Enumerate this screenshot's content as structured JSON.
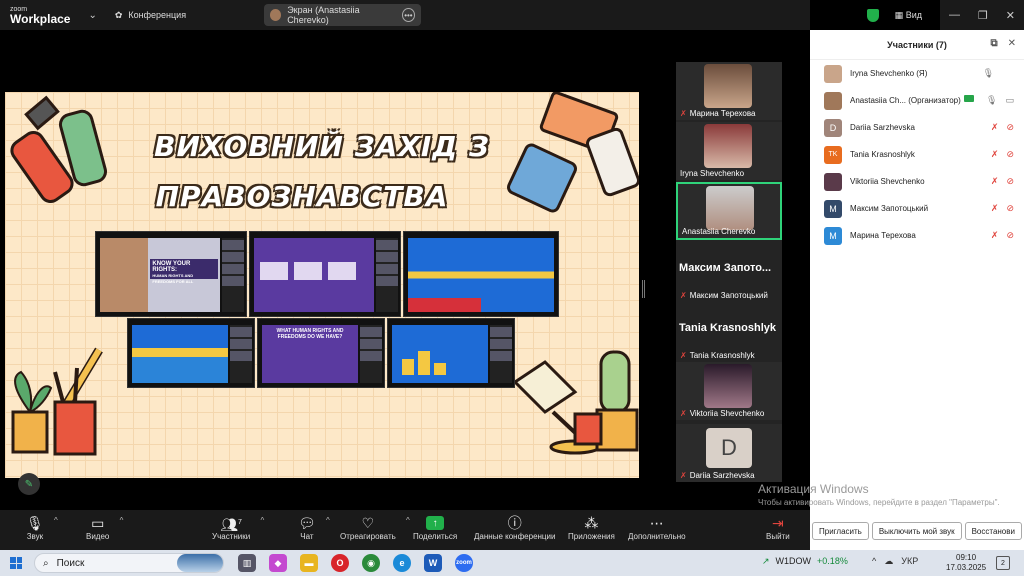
{
  "window": {
    "logo_top": "zoom",
    "logo_bottom": "Workplace",
    "meeting_label": "Конференция",
    "share_label": "Экран (Anastasiia Cherevko)",
    "view_label": "Вид",
    "colors": {
      "accent": "#21b04b",
      "danger": "#e0443d",
      "active_border": "#2fd37a"
    }
  },
  "slide": {
    "title_line1": "ВИХОВНИЙ ЗАХІД З",
    "title_line2": "ПРАВОЗНАВСТВА",
    "thumb1_title": "KNOW YOUR RIGHTS:",
    "thumb1_sub": "HUMAN RIGHTS AND FREEDOMS FOR ALL",
    "thumb5_title": "WHAT HUMAN RIGHTS AND FREEDOMS DO WE HAVE?"
  },
  "strip": {
    "tiles": [
      {
        "name": "Марина Терехова"
      },
      {
        "name": "Iryna Shevchenko"
      },
      {
        "name": "Anastasiia Cherevko"
      },
      {
        "big": "Максим Запото...",
        "name": "Максим Запотоцький"
      },
      {
        "big": "Tania Krasnoshlyk",
        "name": "Tania Krasnoshlyk"
      },
      {
        "name": "Viktoriia Shevchenko"
      },
      {
        "letter": "D",
        "name": "Dariia Sarzhevska"
      }
    ]
  },
  "panel": {
    "title": "Участники (7)",
    "participants": [
      {
        "name": "Iryna Shevchenko (Я)",
        "avatar": "",
        "color": "#c9a58a",
        "mic": "on",
        "video": ""
      },
      {
        "name": "Anastasiia Ch...",
        "role": "(Организатор)",
        "avatar": "",
        "color": "#a0785a",
        "mic": "on",
        "video": "on"
      },
      {
        "name": "Dariia Sarzhevska",
        "avatar": "D",
        "color": "#a0857a",
        "mic": "off",
        "video": "off"
      },
      {
        "name": "Tania Krasnoshlyk",
        "avatar": "TK",
        "color": "#e86c1f",
        "mic": "off",
        "video": "off"
      },
      {
        "name": "Viktoriia Shevchenko",
        "avatar": "",
        "color": "#5a3a4a",
        "mic": "off",
        "video": "off"
      },
      {
        "name": "Максим Запотоцький",
        "avatar": "M",
        "color": "#334a6a",
        "mic": "off",
        "video": "off"
      },
      {
        "name": "Марина Терехова",
        "avatar": "M",
        "color": "#2d8ad6",
        "mic": "off",
        "video": "off"
      }
    ],
    "buttons": {
      "invite": "Пригласить",
      "mute_me": "Выключить мой звук",
      "restore": "Восстанови"
    }
  },
  "activation": {
    "title": "Активация Windows",
    "text": "Чтобы активировать Windows, перейдите в раздел \"Параметры\"."
  },
  "toolbar": {
    "audio": "Звук",
    "video": "Видео",
    "participants": "Участники",
    "participants_count": "7",
    "chat": "Чат",
    "react": "Отреагировать",
    "share": "Поделиться",
    "info": "Данные конференции",
    "apps": "Приложения",
    "more": "Дополнительно",
    "leave": "Выйти"
  },
  "taskbar": {
    "search": "Поиск",
    "stock_name": "W1DOW",
    "stock_change": "+0.18%",
    "lang": "УКР",
    "time": "09:10",
    "date": "17.03.2025",
    "notifications": "2"
  }
}
